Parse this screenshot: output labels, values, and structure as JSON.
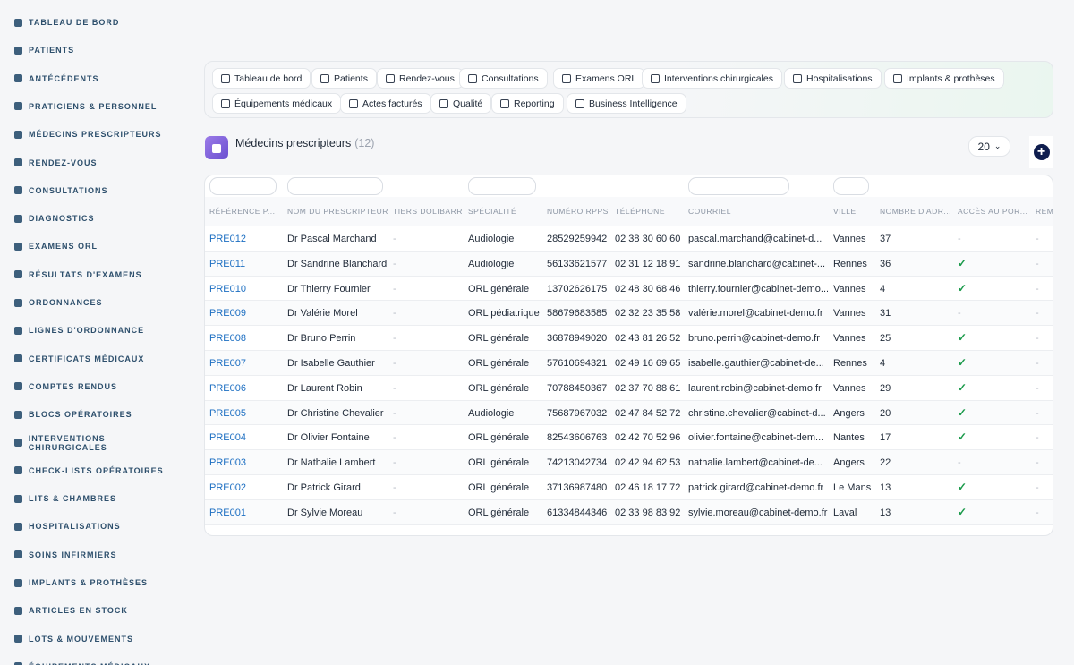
{
  "sidebar": {
    "items": [
      {
        "label": "TABLEAU DE BORD",
        "icon": "dashboard-icon"
      },
      {
        "label": "PATIENTS",
        "icon": "user-icon"
      },
      {
        "label": "ANTÉCÉDENTS",
        "icon": "history-icon"
      },
      {
        "label": "PRATICIENS & PERSONNEL",
        "icon": "user-doctor-icon"
      },
      {
        "label": "MÉDECINS PRESCRIPTEURS",
        "icon": "user-md-icon"
      },
      {
        "label": "RENDEZ-VOUS",
        "icon": "calendar-icon"
      },
      {
        "label": "CONSULTATIONS",
        "icon": "stethoscope-icon"
      },
      {
        "label": "DIAGNOSTICS",
        "icon": "clipboard-icon"
      },
      {
        "label": "EXAMENS ORL",
        "icon": "ear-icon"
      },
      {
        "label": "RÉSULTATS D'EXAMENS",
        "icon": "chart-line-icon"
      },
      {
        "label": "ORDONNANCES",
        "icon": "prescription-icon"
      },
      {
        "label": "LIGNES D'ORDONNANCE",
        "icon": "list-icon"
      },
      {
        "label": "CERTIFICATS MÉDICAUX",
        "icon": "file-medical-icon"
      },
      {
        "label": "COMPTES RENDUS",
        "icon": "file-icon"
      },
      {
        "label": "BLOCS OPÉRATOIRES",
        "icon": "hospital-icon"
      },
      {
        "label": "INTERVENTIONS CHIRURGICALES",
        "icon": "bed-icon"
      },
      {
        "label": "CHECK-LISTS OPÉRATOIRES",
        "icon": "checklist-icon"
      },
      {
        "label": "LITS & CHAMBRES",
        "icon": "building-icon"
      },
      {
        "label": "HOSPITALISATIONS",
        "icon": "bed-pulse-icon"
      },
      {
        "label": "SOINS INFIRMIERS",
        "icon": "heart-icon"
      },
      {
        "label": "IMPLANTS & PROTHÈSES",
        "icon": "hand-holding-icon"
      },
      {
        "label": "ARTICLES EN STOCK",
        "icon": "boxes-icon"
      },
      {
        "label": "LOTS & MOUVEMENTS",
        "icon": "dolly-icon"
      },
      {
        "label": "ÉQUIPEMENTS MÉDICAUX",
        "icon": "tools-icon"
      }
    ]
  },
  "tabs": [
    {
      "label": "Tableau de bord",
      "icon": "dashboard-icon"
    },
    {
      "label": "Patients",
      "icon": "user-icon"
    },
    {
      "label": "Rendez-vous",
      "icon": "calendar-icon"
    },
    {
      "label": "Consultations",
      "icon": "stethoscope-icon"
    },
    {
      "label": "Examens ORL",
      "icon": "ear-icon"
    },
    {
      "label": "Interventions chirurgicales",
      "icon": "bed-icon"
    },
    {
      "label": "Hospitalisations",
      "icon": "bed-pulse-icon"
    },
    {
      "label": "Implants & prothèses",
      "icon": "hand-holding-icon"
    },
    {
      "label": "Équipements médicaux",
      "icon": "tools-icon"
    },
    {
      "label": "Actes facturés",
      "icon": "receipt-icon"
    },
    {
      "label": "Qualité",
      "icon": "clipboard-check-icon"
    },
    {
      "label": "Reporting",
      "icon": "pie-chart-icon"
    },
    {
      "label": "Business Intelligence",
      "icon": "chart-line-icon"
    }
  ],
  "page": {
    "title": "Médecins prescripteurs",
    "count": "(12)",
    "page_size": "20",
    "add_icon": "plus-circle-icon"
  },
  "table": {
    "columns": [
      "RÉFÉRENCE P...",
      "NOM DU PRESCRIPTEUR",
      "TIERS DOLIBARR",
      "SPÉCIALITÉ",
      "NUMÉRO RPPS",
      "TÉLÉPHONE",
      "COURRIEL",
      "VILLE",
      "NOMBRE D'ADR...",
      "ACCÈS AU POR...",
      "REM"
    ],
    "rows": [
      [
        "PRE012",
        "Dr Pascal Marchand",
        "-",
        "Audiologie",
        "28529259942",
        "02 38 30 60 60",
        "pascal.marchand@cabinet-d...",
        "Vannes",
        "37",
        "-",
        "-"
      ],
      [
        "PRE011",
        "Dr Sandrine Blanchard",
        "-",
        "Audiologie",
        "56133621577",
        "02 31 12 18 91",
        "sandrine.blanchard@cabinet-...",
        "Rennes",
        "36",
        "✓",
        "-"
      ],
      [
        "PRE010",
        "Dr Thierry Fournier",
        "-",
        "ORL générale",
        "13702626175",
        "02 48 30 68 46",
        "thierry.fournier@cabinet-demo...",
        "Vannes",
        "4",
        "✓",
        "-"
      ],
      [
        "PRE009",
        "Dr Valérie Morel",
        "-",
        "ORL pédiatrique",
        "58679683585",
        "02 32 23 35 58",
        "valérie.morel@cabinet-demo.fr",
        "Vannes",
        "31",
        "-",
        "-"
      ],
      [
        "PRE008",
        "Dr Bruno Perrin",
        "-",
        "ORL générale",
        "36878949020",
        "02 43 81 26 52",
        "bruno.perrin@cabinet-demo.fr",
        "Vannes",
        "25",
        "✓",
        "-"
      ],
      [
        "PRE007",
        "Dr Isabelle Gauthier",
        "-",
        "ORL générale",
        "57610694321",
        "02 49 16 69 65",
        "isabelle.gauthier@cabinet-de...",
        "Rennes",
        "4",
        "✓",
        "-"
      ],
      [
        "PRE006",
        "Dr Laurent Robin",
        "-",
        "ORL générale",
        "70788450367",
        "02 37 70 88 61",
        "laurent.robin@cabinet-demo.fr",
        "Vannes",
        "29",
        "✓",
        "-"
      ],
      [
        "PRE005",
        "Dr Christine Chevalier",
        "-",
        "Audiologie",
        "75687967032",
        "02 47 84 52 72",
        "christine.chevalier@cabinet-d...",
        "Angers",
        "20",
        "✓",
        "-"
      ],
      [
        "PRE004",
        "Dr Olivier Fontaine",
        "-",
        "ORL générale",
        "82543606763",
        "02 42 70 52 96",
        "olivier.fontaine@cabinet-dem...",
        "Nantes",
        "17",
        "✓",
        "-"
      ],
      [
        "PRE003",
        "Dr Nathalie Lambert",
        "-",
        "ORL générale",
        "74213042734",
        "02 42 94 62 53",
        "nathalie.lambert@cabinet-de...",
        "Angers",
        "22",
        "-",
        "-"
      ],
      [
        "PRE002",
        "Dr Patrick Girard",
        "-",
        "ORL générale",
        "37136987480",
        "02 46 18 17 72",
        "patrick.girard@cabinet-demo.fr",
        "Le Mans",
        "13",
        "✓",
        "-"
      ],
      [
        "PRE001",
        "Dr Sylvie Moreau",
        "-",
        "ORL générale",
        "61334844346",
        "02 33 98 83 92",
        "sylvie.moreau@cabinet-demo.fr",
        "Laval",
        "13",
        "✓",
        "-"
      ]
    ]
  }
}
